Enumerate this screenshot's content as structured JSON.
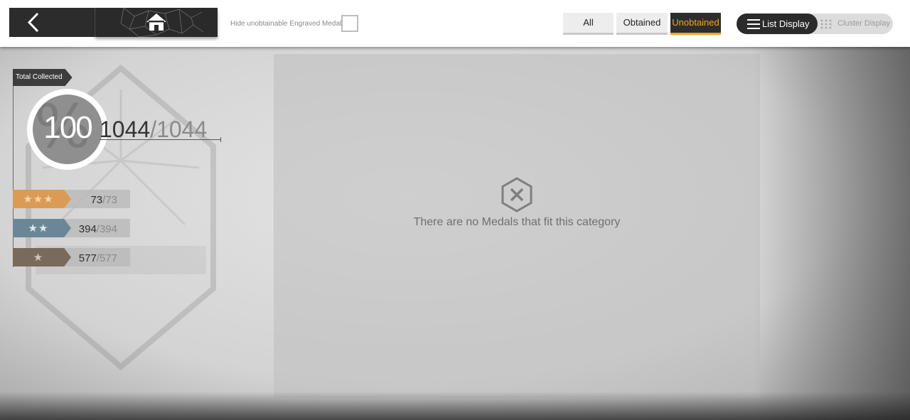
{
  "header": {
    "hide_label": "Hide unobtainable Engraved Medals",
    "filters": [
      {
        "label": "All",
        "active": false
      },
      {
        "label": "Obtained",
        "active": false
      },
      {
        "label": "Unobtained",
        "active": true
      }
    ],
    "display": {
      "list_label": "List Display",
      "cluster_label": "Cluster Display",
      "selected": "list"
    }
  },
  "collection": {
    "title": "Total Collected",
    "percent": "100",
    "collected": "1044",
    "separator": "/",
    "total": "1044",
    "rarities": [
      {
        "stars": "★★★",
        "color": "#d99b55",
        "collected": "73",
        "total": "73"
      },
      {
        "stars": "★★",
        "color": "#6b8797",
        "collected": "394",
        "total": "394"
      },
      {
        "stars": "★",
        "color": "#7a6a5c",
        "collected": "577",
        "total": "577"
      }
    ]
  },
  "empty_state": {
    "icon": "x-hexagon-icon",
    "message": "There are no Medals that fit this category"
  },
  "colors": {
    "accent": "#f2a61c",
    "dark": "#2b2b2b"
  }
}
